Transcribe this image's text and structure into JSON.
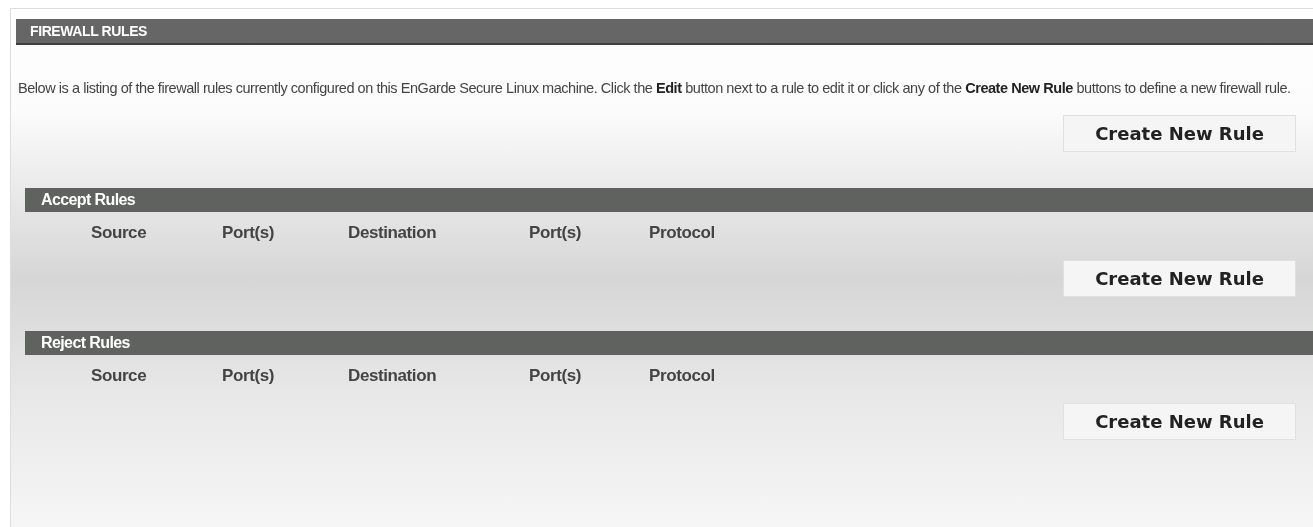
{
  "panel": {
    "title": "FIREWALL RULES",
    "description": "Below is a listing of the firewall rules currently configured on this EnGarde Secure Linux machine. Click the **Edit** button next to a rule to edit it or click any of the **Create New Rule** buttons to define a new firewall rule.",
    "button": "Create New Rule"
  },
  "sections": [
    {
      "title": "Accept Rules",
      "columns": [
        "Source",
        "Port(s)",
        "Destination",
        "Port(s)",
        "Protocol"
      ],
      "button": "Create New Rule"
    },
    {
      "title": "Reject Rules",
      "columns": [
        "Source",
        "Port(s)",
        "Destination",
        "Port(s)",
        "Protocol"
      ],
      "button": "Create New Rule"
    }
  ]
}
